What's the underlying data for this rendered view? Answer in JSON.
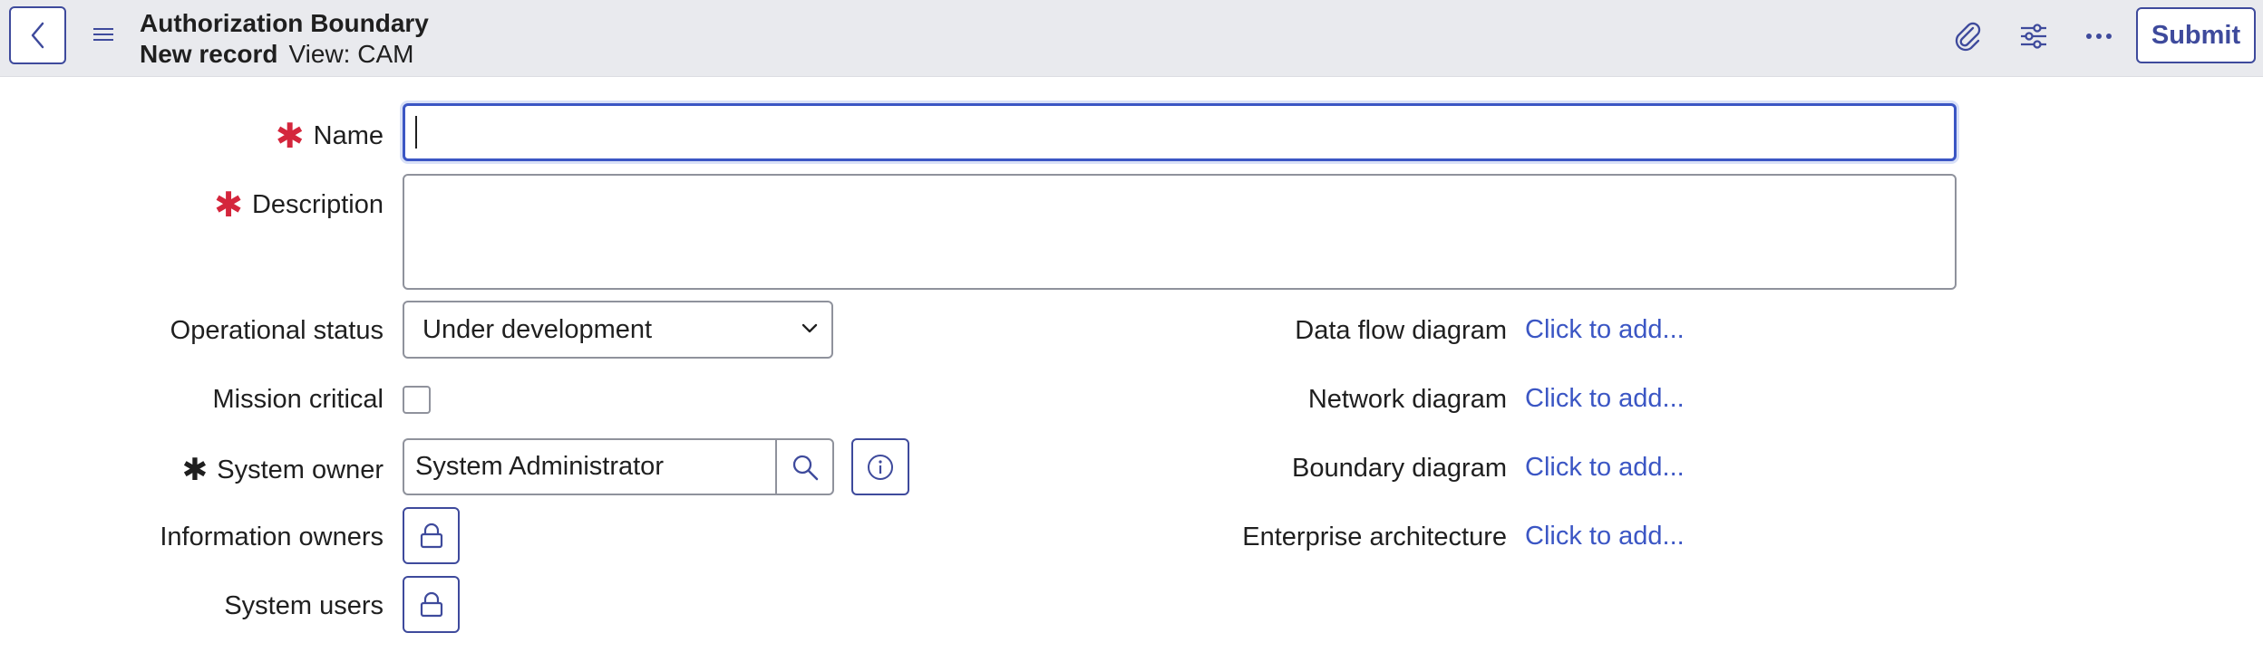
{
  "header": {
    "title": "Authorization Boundary",
    "record_state": "New record",
    "view": "View: CAM",
    "submit_label": "Submit",
    "icons": [
      "back-icon",
      "hamburger-icon",
      "paperclip-icon",
      "sliders-icon",
      "more-icon"
    ]
  },
  "form": {
    "name": {
      "label": "Name",
      "required": true,
      "value": ""
    },
    "description": {
      "label": "Description",
      "required": true,
      "value": ""
    },
    "operational_status": {
      "label": "Operational status",
      "value": "Under development"
    },
    "mission_critical": {
      "label": "Mission critical",
      "checked": false
    },
    "system_owner": {
      "label": "System owner",
      "required": true,
      "value": "System Administrator"
    },
    "information_owners": {
      "label": "Information owners"
    },
    "system_users": {
      "label": "System users"
    }
  },
  "attachments": [
    {
      "label": "Data flow diagram",
      "action": "Click to add..."
    },
    {
      "label": "Network diagram",
      "action": "Click to add..."
    },
    {
      "label": "Boundary diagram",
      "action": "Click to add..."
    },
    {
      "label": "Enterprise architecture",
      "action": "Click to add..."
    }
  ],
  "colors": {
    "accent": "#3e4a9c",
    "link": "#3b56c4",
    "required": "#d4263c",
    "header_bg": "#e9eaee"
  }
}
